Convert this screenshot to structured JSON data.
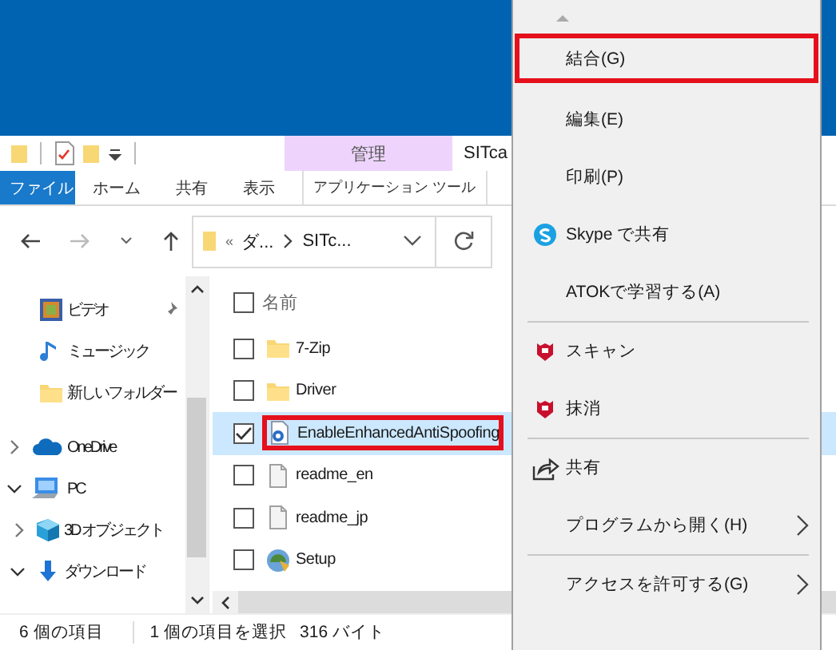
{
  "window": {
    "title": "SITca"
  },
  "ribbon": {
    "context_group": "管理",
    "tabs": [
      {
        "label": "ファイル",
        "kind": "file",
        "selected": false
      },
      {
        "label": "ホーム",
        "kind": "plain",
        "selected": false
      },
      {
        "label": "共有",
        "kind": "plain",
        "selected": false
      },
      {
        "label": "表示",
        "kind": "plain",
        "selected": false
      },
      {
        "label": "アプリケーション ツール",
        "kind": "context",
        "selected": false
      }
    ]
  },
  "address": {
    "overflow": "«",
    "segments": [
      "ダ...",
      "SITc..."
    ]
  },
  "nav_pane": {
    "items": [
      {
        "label": "ビデオ",
        "kind": "video",
        "pinned": true
      },
      {
        "label": "ミュージック",
        "kind": "music"
      },
      {
        "label": "新しいフォルダー",
        "kind": "folder"
      },
      {
        "label": "OneDrive",
        "kind": "cloud",
        "expanded": false
      },
      {
        "label": "PC",
        "kind": "pc",
        "expanded": true,
        "children": [
          {
            "label": "3D オブジェクト",
            "kind": "cube",
            "expanded": false
          },
          {
            "label": "ダウンロード",
            "kind": "download",
            "expanded": true
          }
        ]
      }
    ]
  },
  "file_list": {
    "header": {
      "label": "名前",
      "checked": false
    },
    "rows": [
      {
        "name": "7-Zip",
        "kind": "folder",
        "checked": false,
        "selected": false,
        "marked": false
      },
      {
        "name": "Driver",
        "kind": "folder",
        "checked": false,
        "selected": false,
        "marked": false
      },
      {
        "name": "EnableEnhancedAntiSpoofing",
        "kind": "script",
        "checked": true,
        "selected": true,
        "marked": true
      },
      {
        "name": "readme_en",
        "kind": "text",
        "checked": false,
        "selected": false,
        "marked": false
      },
      {
        "name": "readme_jp",
        "kind": "text",
        "checked": false,
        "selected": false,
        "marked": false
      },
      {
        "name": "Setup",
        "kind": "setup",
        "checked": false,
        "selected": false,
        "marked": false
      }
    ]
  },
  "status_bar": [
    "6 個の項目",
    "1 個の項目を選択",
    "316 バイト"
  ],
  "context_menu": {
    "items": [
      {
        "kind": "plain",
        "label": "結合(G)",
        "marked": true
      },
      {
        "kind": "plain",
        "label": "編集(E)",
        "marked": false
      },
      {
        "kind": "plain",
        "label": "印刷(P)",
        "marked": false
      },
      {
        "kind": "skype",
        "label": "Skype で共有",
        "marked": false
      },
      {
        "kind": "plain",
        "label": "ATOKで学習する(A)",
        "marked": false
      },
      {
        "kind": "separator"
      },
      {
        "kind": "shield",
        "label": "スキャン",
        "marked": false
      },
      {
        "kind": "shield",
        "label": "抹消",
        "marked": false
      },
      {
        "kind": "separator"
      },
      {
        "kind": "share",
        "label": "共有",
        "marked": false
      },
      {
        "kind": "plain",
        "label": "プログラムから開く(H)",
        "submenu": true,
        "marked": false
      },
      {
        "kind": "separator"
      },
      {
        "kind": "plain",
        "label": "アクセスを許可する(G)",
        "submenu": true,
        "marked": false
      }
    ]
  }
}
